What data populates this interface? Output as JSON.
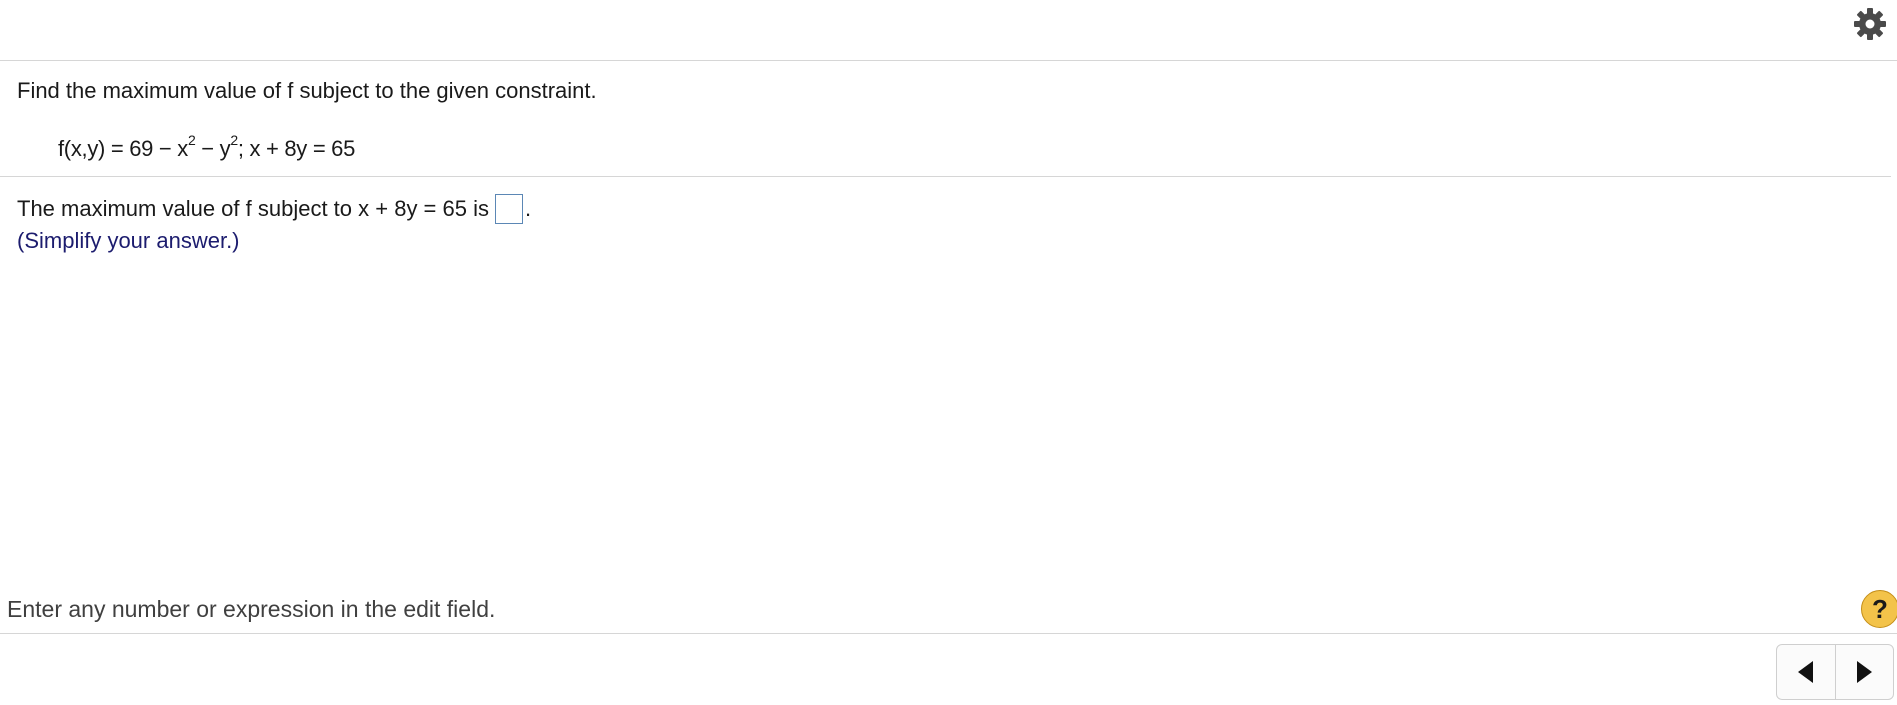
{
  "toolbar": {
    "settings_icon": "gear-icon"
  },
  "question": {
    "instruction": "Find the maximum value of f subject to the given constraint.",
    "formula": {
      "part1": "f(x,y) = 69 − x",
      "exp1": "2",
      "part2": " − y",
      "exp2": "2",
      "part3": "; x + 8y = 65"
    },
    "answer_prefix": "The maximum value of f subject to x + 8y = 65 is",
    "answer_value": "",
    "answer_suffix": ".",
    "hint": "(Simplify your answer.)"
  },
  "footer": {
    "status": "Enter any number or expression in the edit field.",
    "help_label": "?",
    "prev_icon": "triangle-left-icon",
    "next_icon": "triangle-right-icon"
  },
  "colors": {
    "help_button": "#f3c34a",
    "hint_text": "#1c1c6e",
    "answer_box_border": "#5b87b5"
  }
}
